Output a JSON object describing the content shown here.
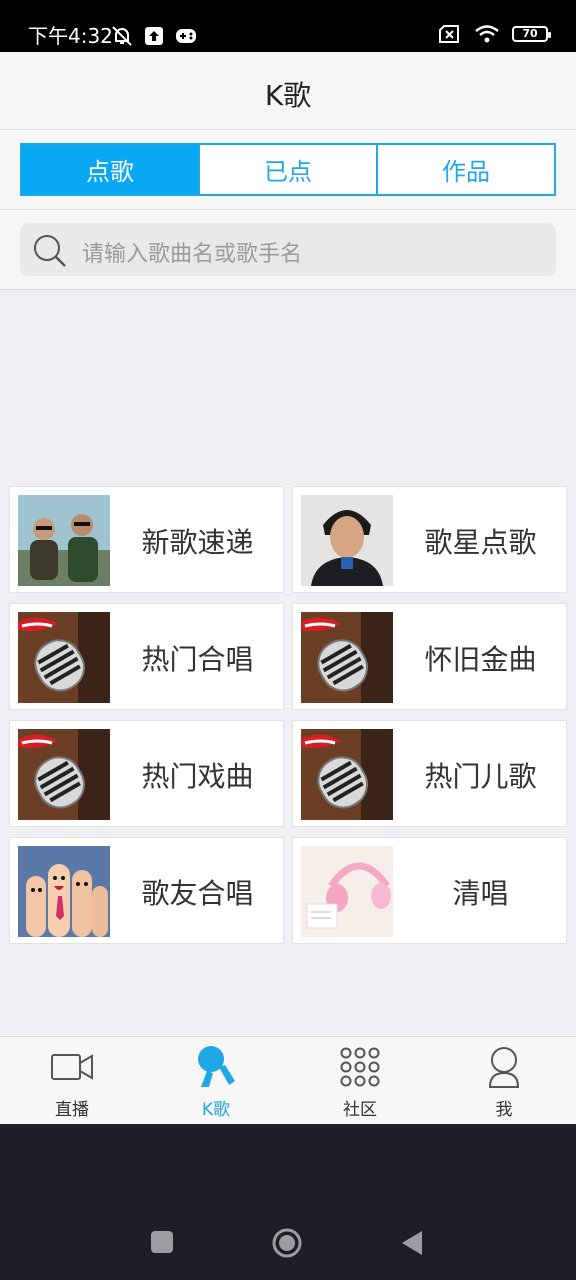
{
  "status_bar": {
    "time": "下午4:32",
    "battery": "70",
    "icons": [
      "bell-muted-icon",
      "upload-icon",
      "gamepad-icon",
      "sim-off-icon",
      "wifi-icon",
      "battery-icon"
    ]
  },
  "header": {
    "title": "K歌"
  },
  "tabs": [
    {
      "label": "点歌",
      "active": true
    },
    {
      "label": "已点",
      "active": false
    },
    {
      "label": "作品",
      "active": false
    }
  ],
  "search": {
    "placeholder": "请输入歌曲名或歌手名",
    "icon": "search-icon"
  },
  "categories": [
    {
      "label": "新歌速递",
      "thumb": "two-men-photo"
    },
    {
      "label": "歌星点歌",
      "thumb": "singer-portrait-photo"
    },
    {
      "label": "热门合唱",
      "thumb": "microphone-photo"
    },
    {
      "label": "怀旧金曲",
      "thumb": "microphone-photo"
    },
    {
      "label": "热门戏曲",
      "thumb": "microphone-photo"
    },
    {
      "label": "热门儿歌",
      "thumb": "microphone-photo"
    },
    {
      "label": "歌友合唱",
      "thumb": "finger-faces-photo"
    },
    {
      "label": "清唱",
      "thumb": "pink-headphones-photo"
    }
  ],
  "bottom_nav": [
    {
      "label": "直播",
      "icon": "video-camera-icon",
      "active": false
    },
    {
      "label": "K歌",
      "icon": "karaoke-mic-icon",
      "active": true
    },
    {
      "label": "社区",
      "icon": "grid-dots-icon",
      "active": false
    },
    {
      "label": "我",
      "icon": "user-icon",
      "active": false
    }
  ],
  "colors": {
    "accent": "#09a8f4",
    "tab_border": "#1fa7e8",
    "system_nav_bg": "#1f1e27"
  }
}
